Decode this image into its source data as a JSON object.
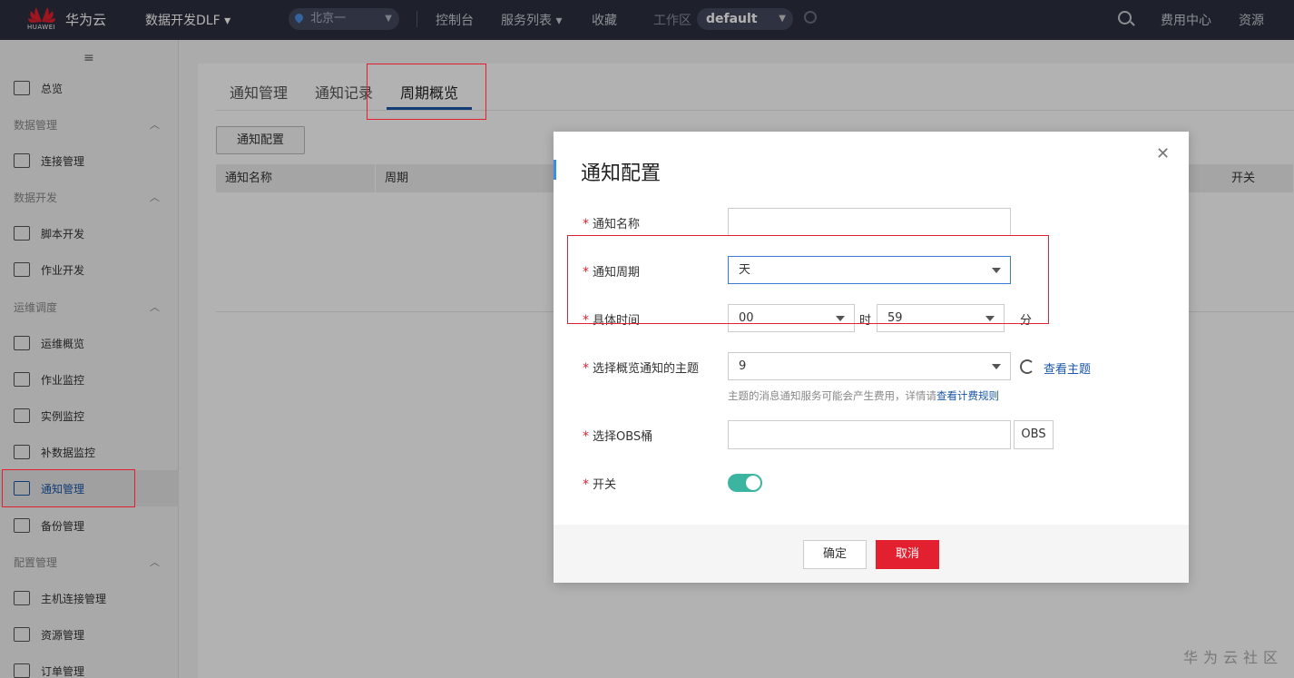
{
  "topbar": {
    "brand": "华为云",
    "logo_text": "HUAWEI",
    "service": "数据开发DLF ▾",
    "region": "北京一",
    "links": [
      "控制台",
      "服务列表 ▾",
      "收藏"
    ],
    "workspace_label": "工作区",
    "workspace_value": "default",
    "right_links": [
      "费用中心",
      "资源"
    ]
  },
  "sidebar": {
    "collapse_icon": "≡",
    "items": [
      {
        "type": "item",
        "label": "总览",
        "icon": "layers-icon"
      },
      {
        "type": "group",
        "label": "数据管理"
      },
      {
        "type": "item",
        "label": "连接管理",
        "icon": "connection-icon"
      },
      {
        "type": "group",
        "label": "数据开发"
      },
      {
        "type": "item",
        "label": "脚本开发",
        "icon": "code-icon"
      },
      {
        "type": "item",
        "label": "作业开发",
        "icon": "workflow-icon"
      },
      {
        "type": "group",
        "label": "运维调度"
      },
      {
        "type": "item",
        "label": "运维概览",
        "icon": "list-icon"
      },
      {
        "type": "item",
        "label": "作业监控",
        "icon": "monitor-icon"
      },
      {
        "type": "item",
        "label": "实例监控",
        "icon": "instance-icon"
      },
      {
        "type": "item",
        "label": "补数据监控",
        "icon": "chart-icon"
      },
      {
        "type": "item",
        "label": "通知管理",
        "icon": "notification-icon",
        "active": true
      },
      {
        "type": "item",
        "label": "备份管理",
        "icon": "backup-icon"
      },
      {
        "type": "group",
        "label": "配置管理"
      },
      {
        "type": "item",
        "label": "主机连接管理",
        "icon": "host-icon"
      },
      {
        "type": "item",
        "label": "资源管理",
        "icon": "resource-icon"
      },
      {
        "type": "item",
        "label": "订单管理",
        "icon": "order-icon"
      }
    ]
  },
  "main": {
    "tabs": [
      "通知管理",
      "通知记录",
      "周期概览"
    ],
    "config_button": "通知配置",
    "columns": [
      "通知名称",
      "周期",
      "开关"
    ]
  },
  "dialog": {
    "title": "通知配置",
    "fields": {
      "name_label": "通知名称",
      "name_value": "",
      "cycle_label": "通知周期",
      "cycle_value": "天",
      "time_label": "具体时间",
      "hour_value": "00",
      "hour_unit": "时",
      "minute_value": "59",
      "minute_unit": "分",
      "topic_label": "选择概览通知的主题",
      "topic_value": "9",
      "topic_link": "查看主题",
      "hint_text": "主题的消息通知服务可能会产生费用，详情请",
      "hint_link": "查看计费规则",
      "obs_label": "选择OBS桶",
      "obs_value": "",
      "obs_button": "OBS",
      "switch_label": "开关",
      "switch_on": true
    },
    "ok_button": "确定",
    "cancel_button": "取消"
  },
  "watermark": "华为云社区",
  "colors": {
    "topbar": "#2b2f3e",
    "accent": "#1a56a8",
    "danger": "#e3202f",
    "toggle": "#3bb4a0"
  }
}
